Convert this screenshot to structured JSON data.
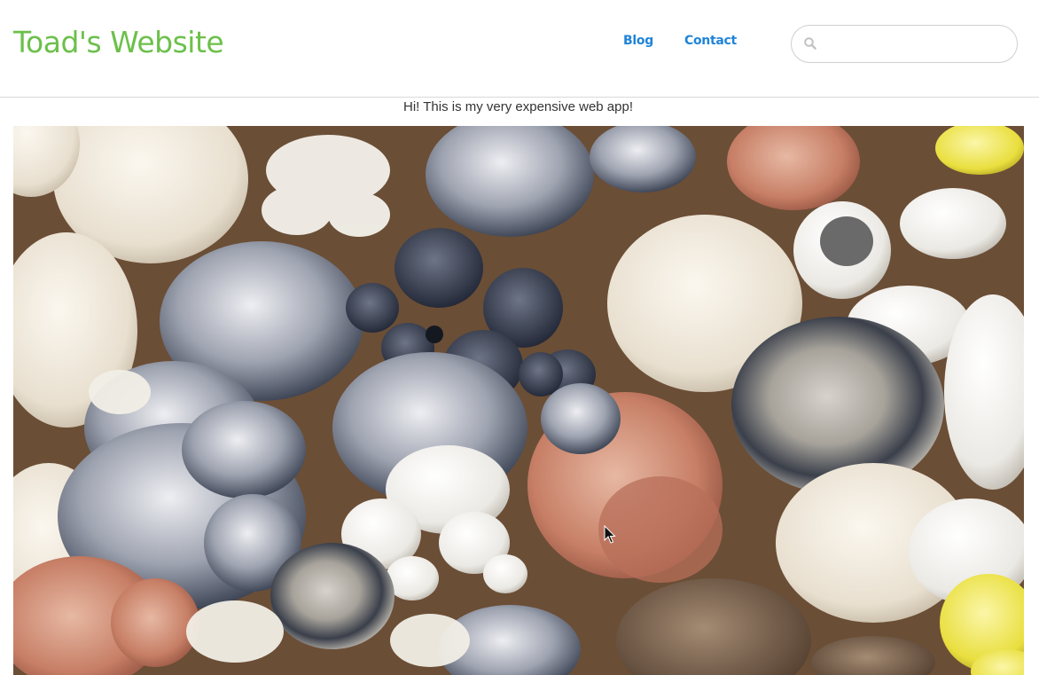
{
  "header": {
    "site_title": "Toad's Website",
    "nav": [
      {
        "label": "Blog"
      },
      {
        "label": "Contact"
      }
    ],
    "search": {
      "placeholder": "",
      "value": ""
    }
  },
  "main": {
    "tagline": "Hi! This is my very expensive web app!",
    "hero_image": {
      "subject": "assorted mushrooms (oyster, lion's mane, coral, pink oyster, golden oyster)"
    }
  },
  "colors": {
    "title_green": "#6cc04a",
    "link_blue": "#1f84d8"
  }
}
